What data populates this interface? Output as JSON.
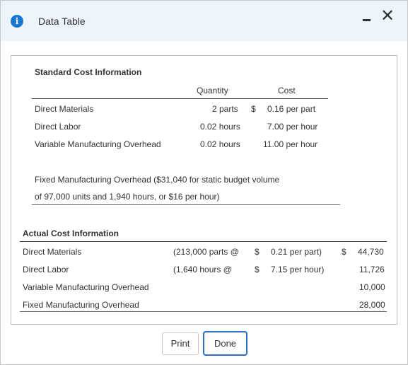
{
  "window": {
    "title": "Data Table",
    "info_icon_glyph": "i",
    "close_glyph": "✕"
  },
  "standard": {
    "heading": "Standard Cost Information",
    "col_quantity": "Quantity",
    "col_cost": "Cost",
    "rows": [
      {
        "label": "Direct Materials",
        "quantity": "2 parts",
        "dollar": "$",
        "cost": "0.16 per part"
      },
      {
        "label": "Direct Labor",
        "quantity": "0.02 hours",
        "dollar": "",
        "cost": "7.00 per hour"
      },
      {
        "label": "Variable Manufacturing Overhead",
        "quantity": "0.02 hours",
        "dollar": "",
        "cost": "11.00 per hour"
      }
    ],
    "fixed_line1": "Fixed Manufacturing Overhead ($31,040 for static budget volume",
    "fixed_line2": "of 97,000 units and 1,940 hours, or $16 per hour)"
  },
  "actual": {
    "heading": "Actual Cost Information",
    "rows": [
      {
        "label": "Direct Materials",
        "detail": "(213,000 parts @",
        "dollar": "$",
        "rate": "0.21 per part)",
        "total_dollar": "$",
        "total": "44,730"
      },
      {
        "label": "Direct Labor",
        "detail": "(1,640 hours @",
        "dollar": "$",
        "rate": "7.15 per hour)",
        "total_dollar": "",
        "total": "11,726"
      },
      {
        "label": "Variable Manufacturing Overhead",
        "detail": "",
        "dollar": "",
        "rate": "",
        "total_dollar": "",
        "total": "10,000"
      },
      {
        "label": "Fixed Manufacturing Overhead",
        "detail": "",
        "dollar": "",
        "rate": "",
        "total_dollar": "",
        "total": "28,000"
      }
    ]
  },
  "buttons": {
    "print": "Print",
    "done": "Done"
  },
  "colors": {
    "titlebar_bg": "#eef4fb",
    "info_icon": "#1976d2",
    "done_border": "#2a6fc4"
  }
}
